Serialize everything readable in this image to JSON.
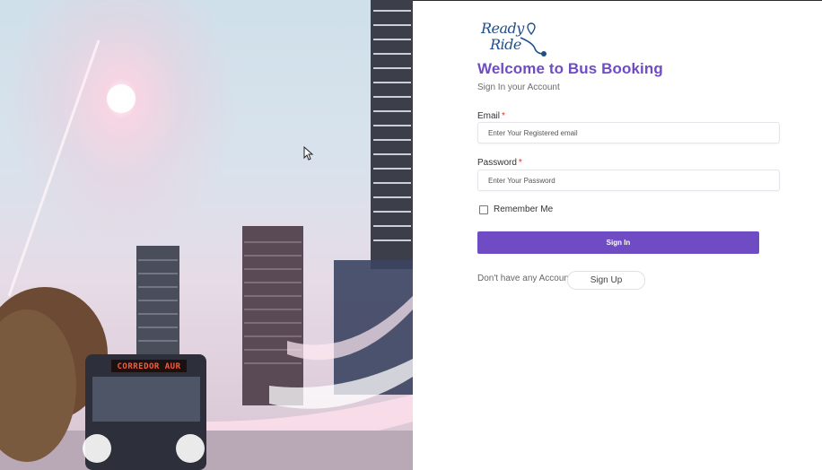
{
  "brand": {
    "logo_line1": "Ready",
    "logo_line2": "Ride",
    "logo_name": "ready-ride-logo",
    "color": "#1f4f8a"
  },
  "login": {
    "title": "Welcome to Bus Booking",
    "subtitle": "Sign In your Account",
    "email_label": "Email",
    "email_placeholder": "Enter Your Registered email",
    "password_label": "Password",
    "password_placeholder": "Enter Your Password",
    "required_marker": "*",
    "remember_label": "Remember Me",
    "remember_checked": false,
    "signin_label": "Sign In",
    "no_account_text": "Don't have any Account?",
    "signup_label": "Sign Up"
  },
  "hero": {
    "bus_sign": "CORREDOR AUR"
  },
  "colors": {
    "accent": "#6f4cc4",
    "required": "#d93025"
  }
}
